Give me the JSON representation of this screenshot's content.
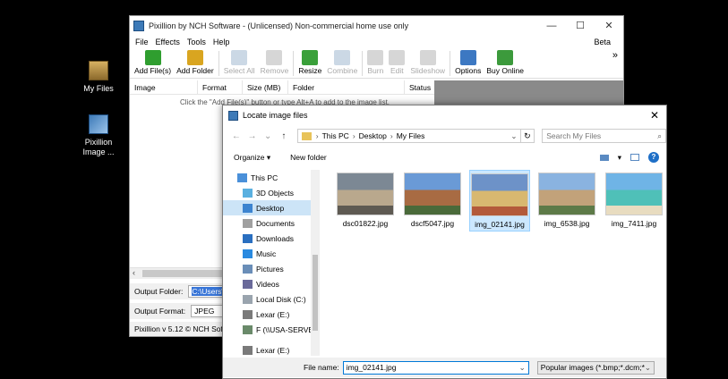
{
  "desktop": {
    "icons": [
      {
        "label": "My Files"
      },
      {
        "label": "Pixillion\nImage ..."
      }
    ]
  },
  "pixillion": {
    "title": "Pixillion by NCH Software - (Unlicensed) Non-commercial home use only",
    "window_buttons": {
      "minimize": "—",
      "maximize": "☐",
      "close": "✕"
    },
    "menu": [
      "File",
      "Effects",
      "Tools",
      "Help"
    ],
    "beta": "Beta",
    "toolbar": [
      {
        "label": "Add File(s)",
        "enabled": true,
        "color": "#2f9e2f"
      },
      {
        "label": "Add Folder",
        "enabled": true,
        "color": "#d9a520"
      },
      {
        "label": "Select All",
        "enabled": false,
        "color": "#6a8fb5"
      },
      {
        "label": "Remove",
        "enabled": false,
        "color": "#8a8a8a"
      },
      {
        "label": "Resize",
        "enabled": true,
        "color": "#3aa03a"
      },
      {
        "label": "Combine",
        "enabled": false,
        "color": "#6a8fb5"
      },
      {
        "label": "Burn",
        "enabled": false,
        "color": "#8a8a8a"
      },
      {
        "label": "Edit",
        "enabled": false,
        "color": "#8a8a8a"
      },
      {
        "label": "Slideshow",
        "enabled": false,
        "color": "#8a8a8a"
      },
      {
        "label": "Options",
        "enabled": true,
        "color": "#3c78c2"
      },
      {
        "label": "Buy Online",
        "enabled": true,
        "color": "#3c9a3c"
      }
    ],
    "more": "»",
    "columns": [
      "Image",
      "Format",
      "Size (MB)",
      "Folder",
      "Status"
    ],
    "hint": "Click the \"Add File(s)\" button or type Alt+A to add to the image list.",
    "output_folder_label": "Output Folder:",
    "output_folder_value": "C:\\Users\\G",
    "output_format_label": "Output Format:",
    "output_format_value": "JPEG",
    "status": "Pixillion v 5.12 © NCH Software"
  },
  "dialog": {
    "title": "Locate image files",
    "close": "✕",
    "nav": {
      "back": "←",
      "forward": "→",
      "dropdown": "⌄",
      "up": "↑"
    },
    "breadcrumb": [
      "This PC",
      "Desktop",
      "My Files"
    ],
    "refresh": "↻",
    "search_placeholder": "Search My Files",
    "search_icon": "⌕",
    "organize": "Organize ▾",
    "new_folder": "New folder",
    "view_menu": "▾",
    "help": "?",
    "nav_items": [
      {
        "label": "This PC",
        "icon": "pc"
      },
      {
        "label": "3D Objects",
        "icon": "objects3d"
      },
      {
        "label": "Desktop",
        "icon": "desktop",
        "selected": true
      },
      {
        "label": "Documents",
        "icon": "documents"
      },
      {
        "label": "Downloads",
        "icon": "downloads"
      },
      {
        "label": "Music",
        "icon": "music"
      },
      {
        "label": "Pictures",
        "icon": "pictures"
      },
      {
        "label": "Videos",
        "icon": "videos"
      },
      {
        "label": "Local Disk (C:)",
        "icon": "disk"
      },
      {
        "label": "Lexar (E:)",
        "icon": "drive"
      },
      {
        "label": "F (\\\\USA-SERVER",
        "icon": "netdrive"
      },
      {
        "label": "Lexar (E:)",
        "icon": "drive"
      }
    ],
    "files": [
      {
        "name": "dsc01822.jpg",
        "colors": [
          "#7c8894",
          "#b9a88d",
          "#5e5a52"
        ]
      },
      {
        "name": "dscf5047.jpg",
        "colors": [
          "#6a9ad6",
          "#a86b43",
          "#4a6a3a"
        ]
      },
      {
        "name": "img_02141.jpg",
        "colors": [
          "#6d92c8",
          "#d8b870",
          "#b35a3a"
        ],
        "selected": true
      },
      {
        "name": "img_6538.jpg",
        "colors": [
          "#8ab3e0",
          "#c2a27a",
          "#5d7a48"
        ]
      },
      {
        "name": "img_7411.jpg",
        "colors": [
          "#6fb4e6",
          "#4fc0b8",
          "#e8dcc0"
        ]
      }
    ],
    "filename_label": "File name:",
    "filename_value": "img_02141.jpg",
    "filter_value": "Popular images (*.bmp;*.dcm;*"
  }
}
